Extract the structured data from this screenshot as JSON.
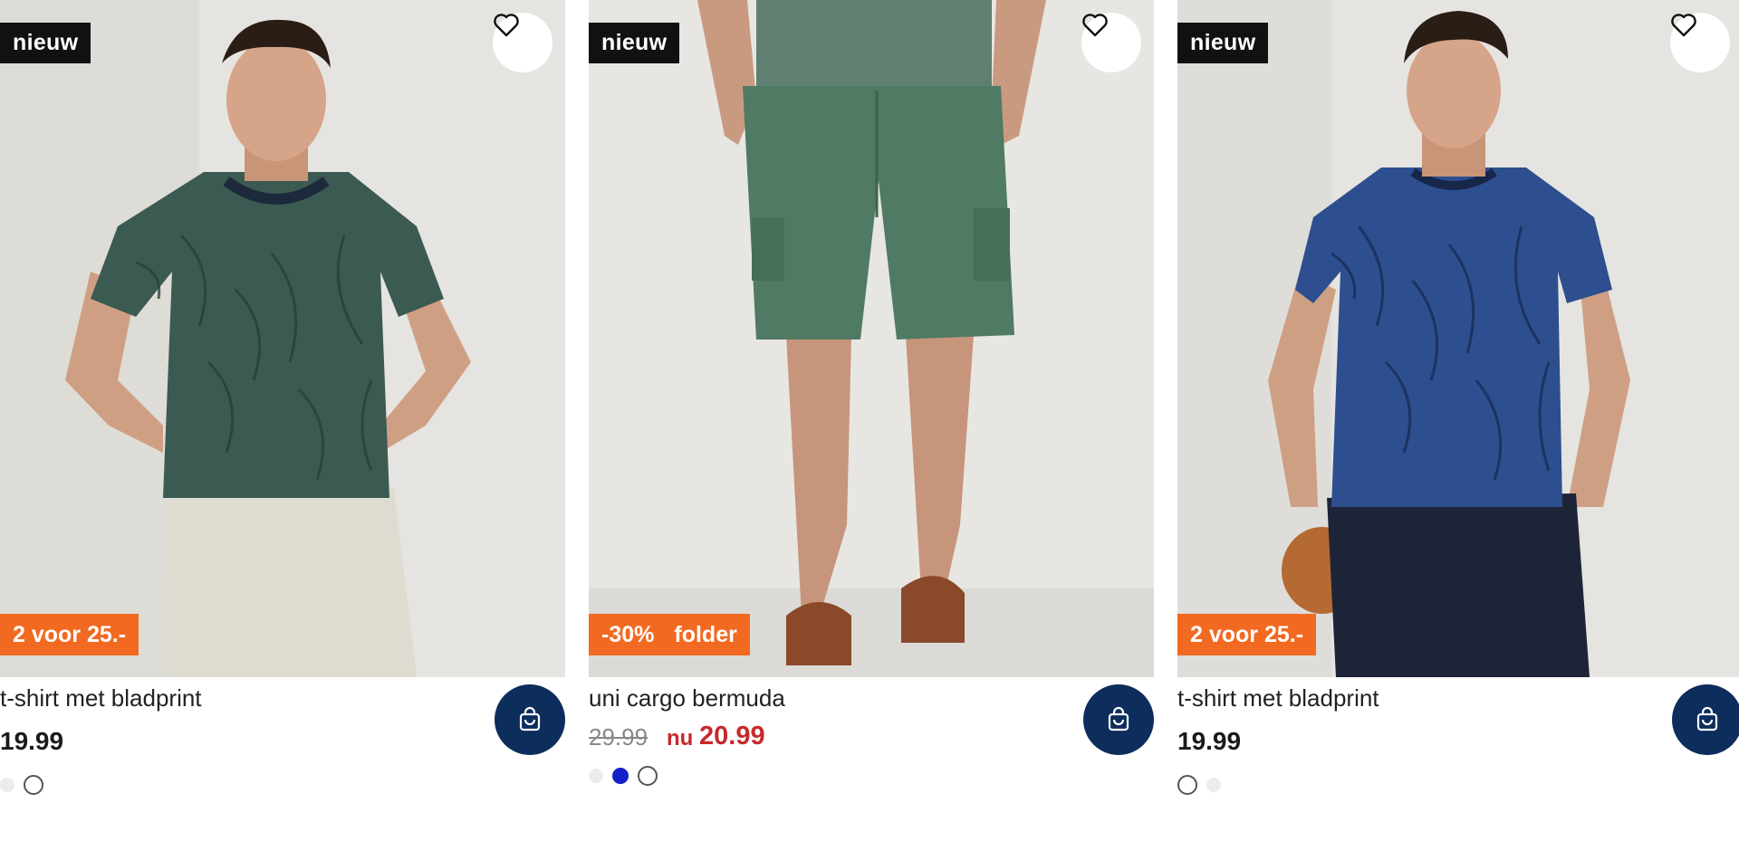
{
  "colors": {
    "new_badge_bg": "#111111",
    "promo_bg": "#f26a21",
    "cart_button_bg": "#0d2d5c",
    "sale_price": "#c8282d"
  },
  "icons": {
    "favorite": "heart-icon",
    "cart": "shopping-bag-icon"
  },
  "products": [
    {
      "badge": "nieuw",
      "promo": "2 voor 25.-",
      "title": "t-shirt met bladprint",
      "price": "19.99",
      "swatches": [
        "light-grey",
        "white"
      ]
    },
    {
      "badge": "nieuw",
      "promo_discount": "-30%",
      "promo_folder": "folder",
      "title": "uni cargo bermuda",
      "price_old": "29.99",
      "price_now_label": "nu",
      "price_now": "20.99",
      "swatches": [
        "light-grey",
        "blue",
        "white"
      ]
    },
    {
      "badge": "nieuw",
      "promo": "2 voor 25.-",
      "title": "t-shirt met bladprint",
      "price": "19.99",
      "swatches": [
        "white",
        "light-grey"
      ]
    }
  ]
}
